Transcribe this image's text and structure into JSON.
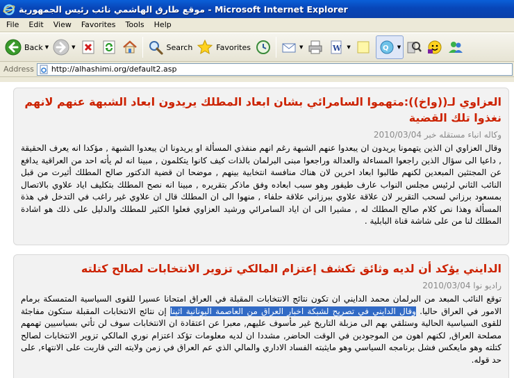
{
  "window": {
    "title": "موقع طارق الهاشمي نائب رئيس الجمهورية - Microsoft Internet Explorer"
  },
  "menu": {
    "items": [
      "File",
      "Edit",
      "View",
      "Favorites",
      "Tools",
      "Help"
    ]
  },
  "toolbar": {
    "back_label": "Back",
    "search_label": "Search",
    "favorites_label": "Favorites"
  },
  "address": {
    "label": "Address",
    "url": "http://alhashimi.org/default2.asp"
  },
  "articles": [
    {
      "headline": "العزاوي لـ((واخ)):متهموا السامرائي بشان ابعاد المطلك يريدون ابعاد الشبهة عنهم لانهم نغذوا تلك القضية",
      "source": "وكاله انباء مستقله خبر",
      "date": "2010/03/04",
      "body": "وقال العزاوي ان الذين يتهمونا يريدون ان يبعدوا عنهم الشبهة رغم انهم منفذي المسألة او يريدونا ان يبعدوا الشبهة , مؤكدا انه يعرف الحقيقة , داعيا الى سؤال الذين راجعوا المساءلة والعدالة وراجعوا مبنى البرلمان بالذات كيف كانوا يتكلمون , مبينا انه لم يأته احد من العراقية يدافع عن المجتثين المبعدين لكنهم طالبوا ابعاد اخرين لان هناك منافسة انتخابية بينهم , موضحا ان قضية الدكتور صالح المطلك أثيرت من قبل النائب الثاني لرئيس مجلس النواب عارف طيفور وهو سبب ابعاده وفق ماذكر بتقريره , مبينا انه نصح المطلك بتكليف اياد علاوي بالاتصال بمسعود برزاني لسحب التقرير لان علاقة علاوي ببرزاني علاقة حلفاء , منهوا الى ان المطلك قال ان علاوي غير راغب في التدخل في هذة المسألة وهذا نص كلام صالح المطلك له , مشيرا الى ان اياد السامرائي ورشيد العزاوي فعلوا الكثير للمطلك والدليل على ذلك هو اشادة المطلك لنا من على شاشة قناة البابلية ."
    },
    {
      "headline": "الدايني يؤكد أن لديه وثائق تكشف إعتزام المالكي تزوير الانتخابات لصالح كتلته",
      "source": "راديو نوا",
      "date": "2010/03/04",
      "body_before": "توقع النائب المبعد من البرلمان محمد الدايني ان تكون نتائج الانتخابات المقبلة في العراق امتحانا عسيرا للقوى السياسية المتمسكة برمام الامور في العراق حاليا. ",
      "body_selected": "وقال الدايني في تصريح لشبكة اخبار العراق من العاصمة اليونانية اثينا",
      "body_after": " إن نتائج الانتخابات المقبلة ستكون مفاجئة للقوى السياسية الحالية وستلقي بهم الى مزبلة التاريخ غير مأسوف عليهم, معبرا عن اعتقادة ان الانتخابات سوف لن تأتي بسياسيين تهمهم مصلحة العراق, لكنهم اهون من الموجودين في الوقت الحاضر, مشددا ان لديه معلومات تؤكد اعتزام نوري المالكي تزوير الانتخابات لصالح كتلته وهو مايعكس فشل برنامجه السياسي وهو مايثبته الفساد الاداري والمالي الذي عم العراق في زمن ولايته التي قاربت على الانتهاء, على حد قوله."
    }
  ]
}
